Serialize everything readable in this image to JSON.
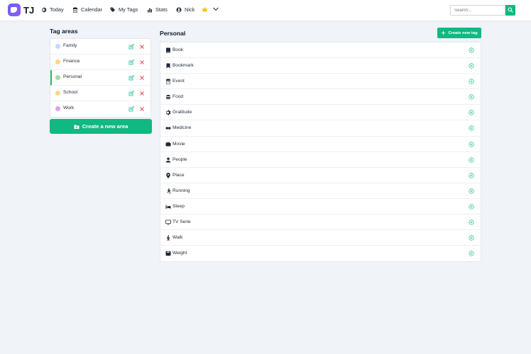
{
  "header": {
    "brand": "TJ",
    "nav": [
      {
        "label": "Today",
        "icon": "gear-icon"
      },
      {
        "label": "Calendar",
        "icon": "calendar-icon"
      },
      {
        "label": "My Tags",
        "icon": "tags-icon"
      },
      {
        "label": "Stats",
        "icon": "bar-chart-icon"
      },
      {
        "label": "Nick",
        "icon": "user-icon"
      }
    ],
    "search_placeholder": "Search..."
  },
  "tag_areas": {
    "title": "Tag areas",
    "items": [
      {
        "label": "Family",
        "color": "#bfdbfe"
      },
      {
        "label": "Finance",
        "color": "#fcd58a"
      },
      {
        "label": "Personal",
        "color": "#a7d9a0",
        "active": true
      },
      {
        "label": "School",
        "color": "#fcd58a"
      },
      {
        "label": "Work",
        "color": "#d8a3e6"
      }
    ],
    "create_label": "Create a new area"
  },
  "tags": {
    "title": "Personal",
    "create_label": "Create new tag",
    "items": [
      {
        "label": "Book",
        "icon": "book-icon"
      },
      {
        "label": "Bookmark",
        "icon": "bookmark-icon"
      },
      {
        "label": "Event",
        "icon": "calendar-icon"
      },
      {
        "label": "Food",
        "icon": "burger-icon"
      },
      {
        "label": "Gratitude",
        "icon": "gear-icon"
      },
      {
        "label": "Medicine",
        "icon": "pills-icon"
      },
      {
        "label": "Movie",
        "icon": "film-icon"
      },
      {
        "label": "People",
        "icon": "person-icon"
      },
      {
        "label": "Place",
        "icon": "map-pin-icon"
      },
      {
        "label": "Running",
        "icon": "running-icon"
      },
      {
        "label": "Sleep",
        "icon": "bed-icon"
      },
      {
        "label": "TV Serie",
        "icon": "tv-icon"
      },
      {
        "label": "Walk",
        "icon": "walking-icon"
      },
      {
        "label": "Weight",
        "icon": "scale-icon"
      }
    ]
  },
  "colors": {
    "accent": "#10b981",
    "danger": "#ef4444",
    "active_border": "#22c55e"
  }
}
